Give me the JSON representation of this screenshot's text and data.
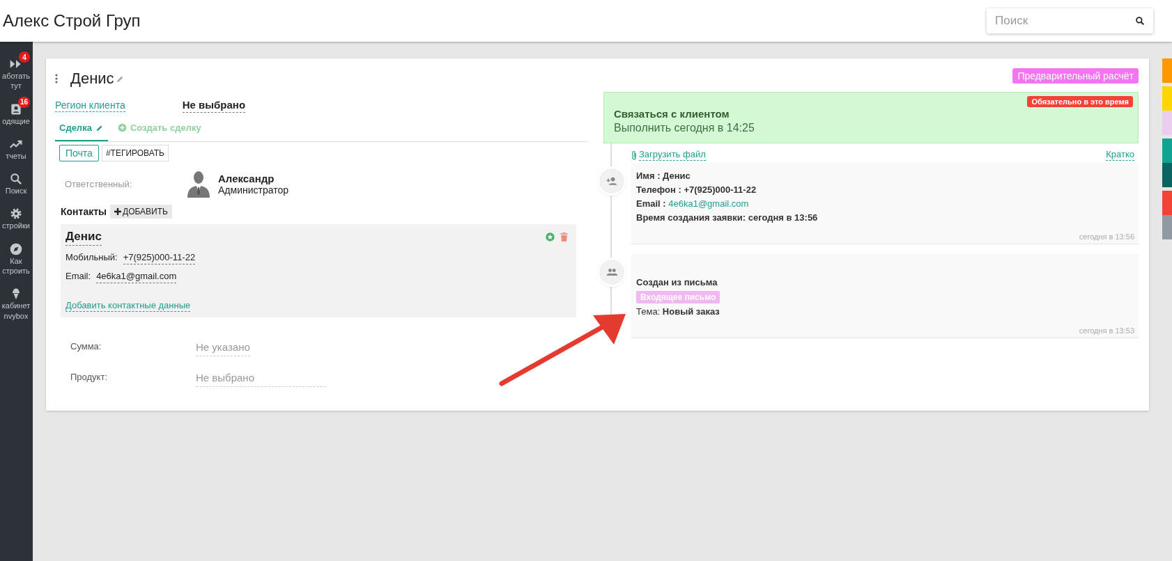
{
  "header": {
    "title": "Алекс Строй Груп",
    "search": {
      "placeholder": "Поиск"
    }
  },
  "sidebar": {
    "items": [
      {
        "kind": "forward",
        "label": "аботать тут",
        "badge": "4"
      },
      {
        "kind": "contact",
        "label": "одящие",
        "badge": "16"
      },
      {
        "kind": "trend",
        "label": "тчеты"
      },
      {
        "kind": "search",
        "label": "Поиск"
      },
      {
        "kind": "gear",
        "label": "стройки"
      },
      {
        "kind": "compass",
        "label": "Как строить"
      },
      {
        "kind": "cone",
        "label": "кабинет nvybox"
      }
    ]
  },
  "color_tabs": [
    {
      "color": "#ff9800"
    },
    {
      "color": "#ffd600"
    },
    {
      "color": "#ebcdef"
    },
    {
      "color": "#0fa394"
    },
    {
      "color": "#0a6462"
    },
    {
      "color": "#f44336"
    },
    {
      "color": "#909aa2"
    }
  ],
  "card": {
    "name": "Денис",
    "stage": "Предварительный расчёт",
    "region": {
      "label": "Регион клиента",
      "value": "Не выбрано"
    },
    "tabs": [
      {
        "kind": "edit",
        "label": "Сделка",
        "selected": true
      },
      {
        "kind": "create",
        "label": "Создать сделку",
        "selected": false
      }
    ],
    "source_buttons": [
      {
        "label": "Почта",
        "selected": true
      },
      {
        "label": "#ТЕГИРОВАТЬ",
        "selected": false
      }
    ],
    "responsible": {
      "label": "Ответственный:",
      "name": "Александр",
      "role": "Администратор"
    },
    "contacts": {
      "title": "Контакты",
      "add_button": "ДОБАВИТЬ",
      "items": [
        {
          "name": "Денис",
          "fields": [
            {
              "label": "Мобильный:",
              "value": "+7(925)000-11-22"
            },
            {
              "label": "Email:",
              "value": "4e6ka1@gmail.com"
            }
          ],
          "add_link": "Добавить контактные данные"
        }
      ]
    },
    "fields": [
      {
        "label": "Сумма:",
        "placeholder": "Не указано"
      },
      {
        "label": "Продукт:",
        "placeholder": "Не выбрано"
      }
    ]
  },
  "task": {
    "title": "Связаться с клиентом",
    "due": "Выполнить сегодня в 14:25",
    "badge": "Обязательно в это время"
  },
  "timeline": {
    "upload_link": "Загрузить файл",
    "brief_link": "Кратко",
    "entries": [
      {
        "kind": "lead",
        "lines": [
          {
            "text": "Имя : Денис"
          },
          {
            "text": "Телефон : +7(925)000-11-22"
          },
          {
            "text": "Email :",
            "link": "4e6ka1@gmail.com"
          },
          {
            "text": "Время создания заявки: сегодня в 13:56"
          }
        ],
        "time": "сегодня в 13:56"
      },
      {
        "kind": "email",
        "lines": [
          {
            "text": "Создан из письма"
          },
          {
            "tag": "Входящее письмо"
          },
          {
            "text": "Тема: **Новый заказ**"
          }
        ],
        "time": "сегодня в 13:53"
      }
    ]
  }
}
